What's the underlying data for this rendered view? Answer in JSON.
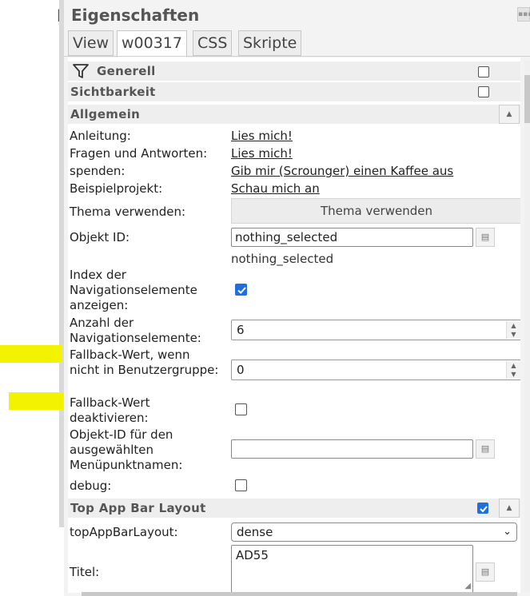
{
  "left_pane": {
    "cut_letter": "b"
  },
  "panel": {
    "title": "Eigenschaften",
    "tabs": [
      "View",
      "w00317",
      "CSS",
      "Skripte"
    ],
    "active_tab": "w00317"
  },
  "groups": {
    "generell": "Generell",
    "sichtbarkeit": "Sichtbarkeit",
    "allgemein": "Allgemein",
    "top_app_bar": "Top App Bar Layout"
  },
  "rows": {
    "anleitung": {
      "label": "Anleitung:",
      "link": "Lies mich!"
    },
    "faq": {
      "label": "Fragen und Antworten:",
      "link": "Lies mich!"
    },
    "spenden": {
      "label": "spenden:",
      "link": "Gib mir (Scrounger) einen Kaffee aus"
    },
    "beispiel": {
      "label": "Beispielprojekt:",
      "link": "Schau mich an"
    },
    "thema": {
      "label": "Thema verwenden:",
      "button": "Thema verwenden"
    },
    "objekt_id": {
      "label": "Objekt ID:",
      "value": "nothing_selected",
      "hint": "nothing_selected"
    },
    "index_nav": {
      "label": "Index der Navigationselemente anzeigen:",
      "checked": true
    },
    "anzahl_nav": {
      "label": "Anzahl der Navigationselemente:",
      "value": "6"
    },
    "fallback": {
      "label": "Fallback-Wert, wenn nicht in Benutzergruppe:",
      "value": "0"
    },
    "fallback_deakt": {
      "label": "Fallback-Wert deaktivieren:",
      "checked": false
    },
    "objekt_menu": {
      "label": "Objekt-ID für den ausgewählten Menüpunktnamen:",
      "value": ""
    },
    "debug": {
      "label": "debug:",
      "checked": false
    },
    "layout": {
      "label": "topAppBarLayout:",
      "value": "dense"
    },
    "titel": {
      "label": "Titel:",
      "value": "AD55"
    }
  },
  "states": {
    "generell_checked": false,
    "sichtbarkeit_checked": false,
    "top_app_bar_checked": true
  },
  "icons": {
    "filter": "filter-icon",
    "expand": "expand-icon",
    "collapse": "collapse-icon",
    "select_object": "select-object-icon",
    "dropdown": "chevron-down-icon",
    "spin": "spinner-arrows-icon"
  },
  "colors": {
    "checkbox_checked": "#1f6fde",
    "highlight": "#f3f200",
    "group_header_bg": "#eeeeee"
  }
}
